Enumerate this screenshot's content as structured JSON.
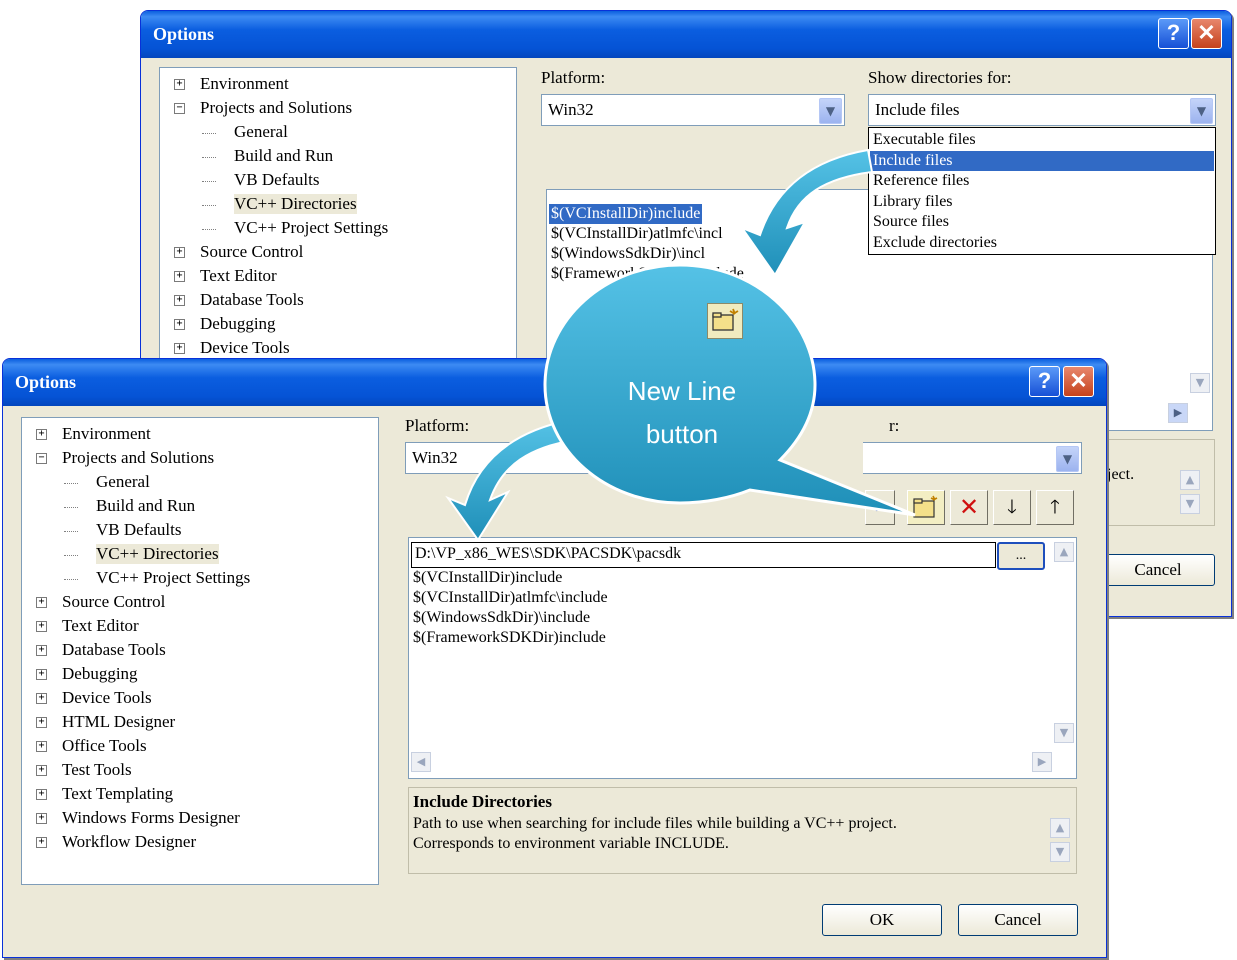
{
  "back_window": {
    "title": "Options",
    "help_symbol": "?",
    "close_symbol": "✕",
    "tree": [
      {
        "label": "Environment",
        "kind": "collapsed"
      },
      {
        "label": "Projects and Solutions",
        "kind": "expanded"
      },
      {
        "label": "General",
        "kind": "leaf"
      },
      {
        "label": "Build and Run",
        "kind": "leaf"
      },
      {
        "label": "VB Defaults",
        "kind": "leaf"
      },
      {
        "label": "VC++ Directories",
        "kind": "leaf",
        "selected": true
      },
      {
        "label": "VC++ Project Settings",
        "kind": "leaf"
      },
      {
        "label": "Source Control",
        "kind": "collapsed"
      },
      {
        "label": "Text Editor",
        "kind": "collapsed"
      },
      {
        "label": "Database Tools",
        "kind": "collapsed"
      },
      {
        "label": "Debugging",
        "kind": "collapsed"
      },
      {
        "label": "Device Tools",
        "kind": "collapsed"
      }
    ],
    "platform_label": "Platform:",
    "platform_value": "Win32",
    "show_dirs_label": "Show directories for:",
    "show_dirs_value": "Include files",
    "show_dirs_options": [
      "Executable files",
      "Include files",
      "Reference files",
      "Library files",
      "Source files",
      "Exclude directories"
    ],
    "show_dirs_selected_index": 1,
    "dir_list": [
      "$(VCInstallDir)include",
      "$(VCInstallDir)atlmfc\\incl",
      "$(WindowsSdkDir)\\incl",
      "$(FrameworkSDKDir)include"
    ],
    "desc_fragment": "oject.",
    "cancel_label": "Cancel"
  },
  "front_window": {
    "title": "Options",
    "help_symbol": "?",
    "close_symbol": "✕",
    "tree": [
      {
        "label": "Environment",
        "kind": "collapsed"
      },
      {
        "label": "Projects and Solutions",
        "kind": "expanded"
      },
      {
        "label": "General",
        "kind": "leaf"
      },
      {
        "label": "Build and Run",
        "kind": "leaf"
      },
      {
        "label": "VB Defaults",
        "kind": "leaf"
      },
      {
        "label": "VC++ Directories",
        "kind": "leaf",
        "selected": true
      },
      {
        "label": "VC++ Project Settings",
        "kind": "leaf"
      },
      {
        "label": "Source Control",
        "kind": "collapsed"
      },
      {
        "label": "Text Editor",
        "kind": "collapsed"
      },
      {
        "label": "Database Tools",
        "kind": "collapsed"
      },
      {
        "label": "Debugging",
        "kind": "collapsed"
      },
      {
        "label": "Device Tools",
        "kind": "collapsed"
      },
      {
        "label": "HTML Designer",
        "kind": "collapsed"
      },
      {
        "label": "Office Tools",
        "kind": "collapsed"
      },
      {
        "label": "Test Tools",
        "kind": "collapsed"
      },
      {
        "label": "Text Templating",
        "kind": "collapsed"
      },
      {
        "label": "Windows Forms Designer",
        "kind": "collapsed"
      },
      {
        "label": "Workflow Designer",
        "kind": "collapsed"
      }
    ],
    "platform_label": "Platform:",
    "platform_value": "Win32",
    "show_dirs_fragment": "r:",
    "new_entry_value": "D:\\VP_x86_WES\\SDK\\PACSDK\\pacsdk",
    "browse_label": "...",
    "dir_list": [
      "$(VCInstallDir)include",
      "$(VCInstallDir)atlmfc\\include",
      "$(WindowsSdkDir)\\include",
      "$(FrameworkSDKDir)include"
    ],
    "desc_title": "Include Directories",
    "desc_line1": "Path to use when searching for include files while building a VC++ project.",
    "desc_line2": "Corresponds to environment variable INCLUDE.",
    "ok_label": "OK",
    "cancel_label": "Cancel"
  },
  "callout": {
    "line1": "New Line",
    "line2": "button",
    "icon": "new-folder-icon",
    "bubble_color": "#2aa3c9",
    "arrow_color": "#2aa3c9"
  }
}
